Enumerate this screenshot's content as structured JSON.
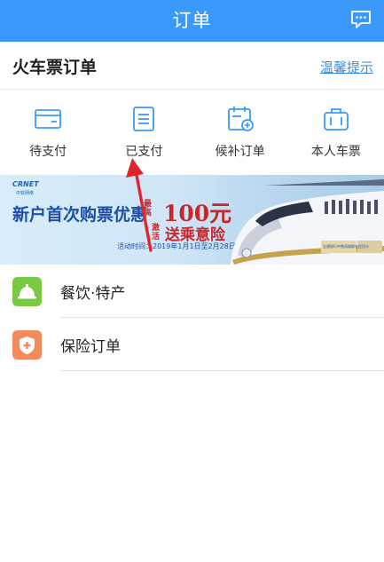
{
  "header": {
    "title": "订单",
    "message_icon": "message-icon"
  },
  "section": {
    "title": "火车票订单",
    "tip_link": "温馨提示"
  },
  "quick_actions": [
    {
      "label": "待支付",
      "icon": "wallet-icon"
    },
    {
      "label": "已支付",
      "icon": "document-icon"
    },
    {
      "label": "候补订单",
      "icon": "calendar-add-icon"
    },
    {
      "label": "本人车票",
      "icon": "luggage-icon"
    }
  ],
  "banner": {
    "logo": "CRNET",
    "logo_sub": "中铁网络",
    "headline": "新户首次购票优惠",
    "max_label": "最高",
    "amount": "100元",
    "activate_label": "激活",
    "gift": "送乘意险",
    "date_text": "活动时间：2019年1月1日至2月28日",
    "bank_text": "交通银行中铁网络联名信用卡"
  },
  "list": [
    {
      "label": "餐饮·特产",
      "icon": "food-bell-icon",
      "color": "#7ac943"
    },
    {
      "label": "保险订单",
      "icon": "shield-plus-icon",
      "color": "#f48a5a"
    }
  ],
  "colors": {
    "primary": "#3b99fc",
    "link": "#3b8de8",
    "annotation": "#e0262c"
  }
}
